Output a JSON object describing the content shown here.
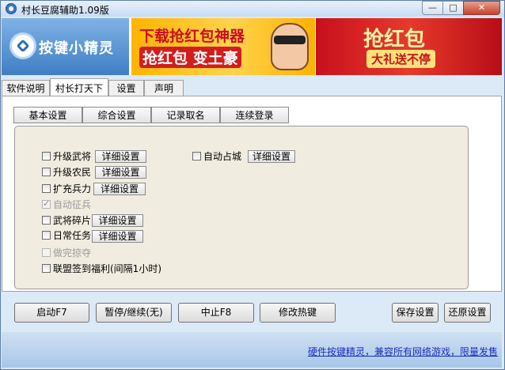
{
  "window": {
    "title": "村长豆腐辅助1.09版",
    "min_glyph": "—",
    "max_glyph": "□",
    "close_glyph": "✕"
  },
  "banner": {
    "logo_text": "按键小精灵",
    "ad1_line1": "下载抢红包神器",
    "ad1_line2": "抢红包 变土豪",
    "ad2_line1": "抢红包",
    "ad2_line2": "大礼送不停"
  },
  "tabs": [
    {
      "label": "软件说明",
      "active": false
    },
    {
      "label": "村长打天下",
      "active": true
    },
    {
      "label": "设置",
      "active": false
    },
    {
      "label": "声明",
      "active": false
    }
  ],
  "subtabs": [
    "基本设置",
    "综合设置",
    "记录取名",
    "连续登录"
  ],
  "options": {
    "upgrade_general": {
      "label": "升级武将",
      "checked": false,
      "detail": "详细设置"
    },
    "upgrade_peasant": {
      "label": "升级农民",
      "checked": false,
      "detail": "详细设置"
    },
    "expand_troops": {
      "label": "扩充兵力",
      "checked": false,
      "detail": "详细设置"
    },
    "auto_conscript": {
      "label": "自动征兵",
      "checked": true,
      "disabled": true
    },
    "general_fragments": {
      "label": "武将碎片",
      "checked": false,
      "detail": "详细设置"
    },
    "daily_tasks": {
      "label": "日常任务",
      "checked": false,
      "detail": "详细设置"
    },
    "finish_plunder": {
      "label": "做完掠夺",
      "checked": false,
      "disabled": true
    },
    "alliance_signin": {
      "label": "联盟签到福利(间隔1小时)",
      "checked": false
    },
    "auto_occupy_city": {
      "label": "自动占城",
      "checked": false,
      "detail": "详细设置"
    }
  },
  "buttons": {
    "start": "启动F7",
    "pause": "暂停/继续(无)",
    "stop": "中止F8",
    "hotkey": "修改热键",
    "save": "保存设置",
    "restore": "还原设置"
  },
  "footer": {
    "link_text": "硬件按键精灵，兼容所有网络游戏，限量发售"
  }
}
